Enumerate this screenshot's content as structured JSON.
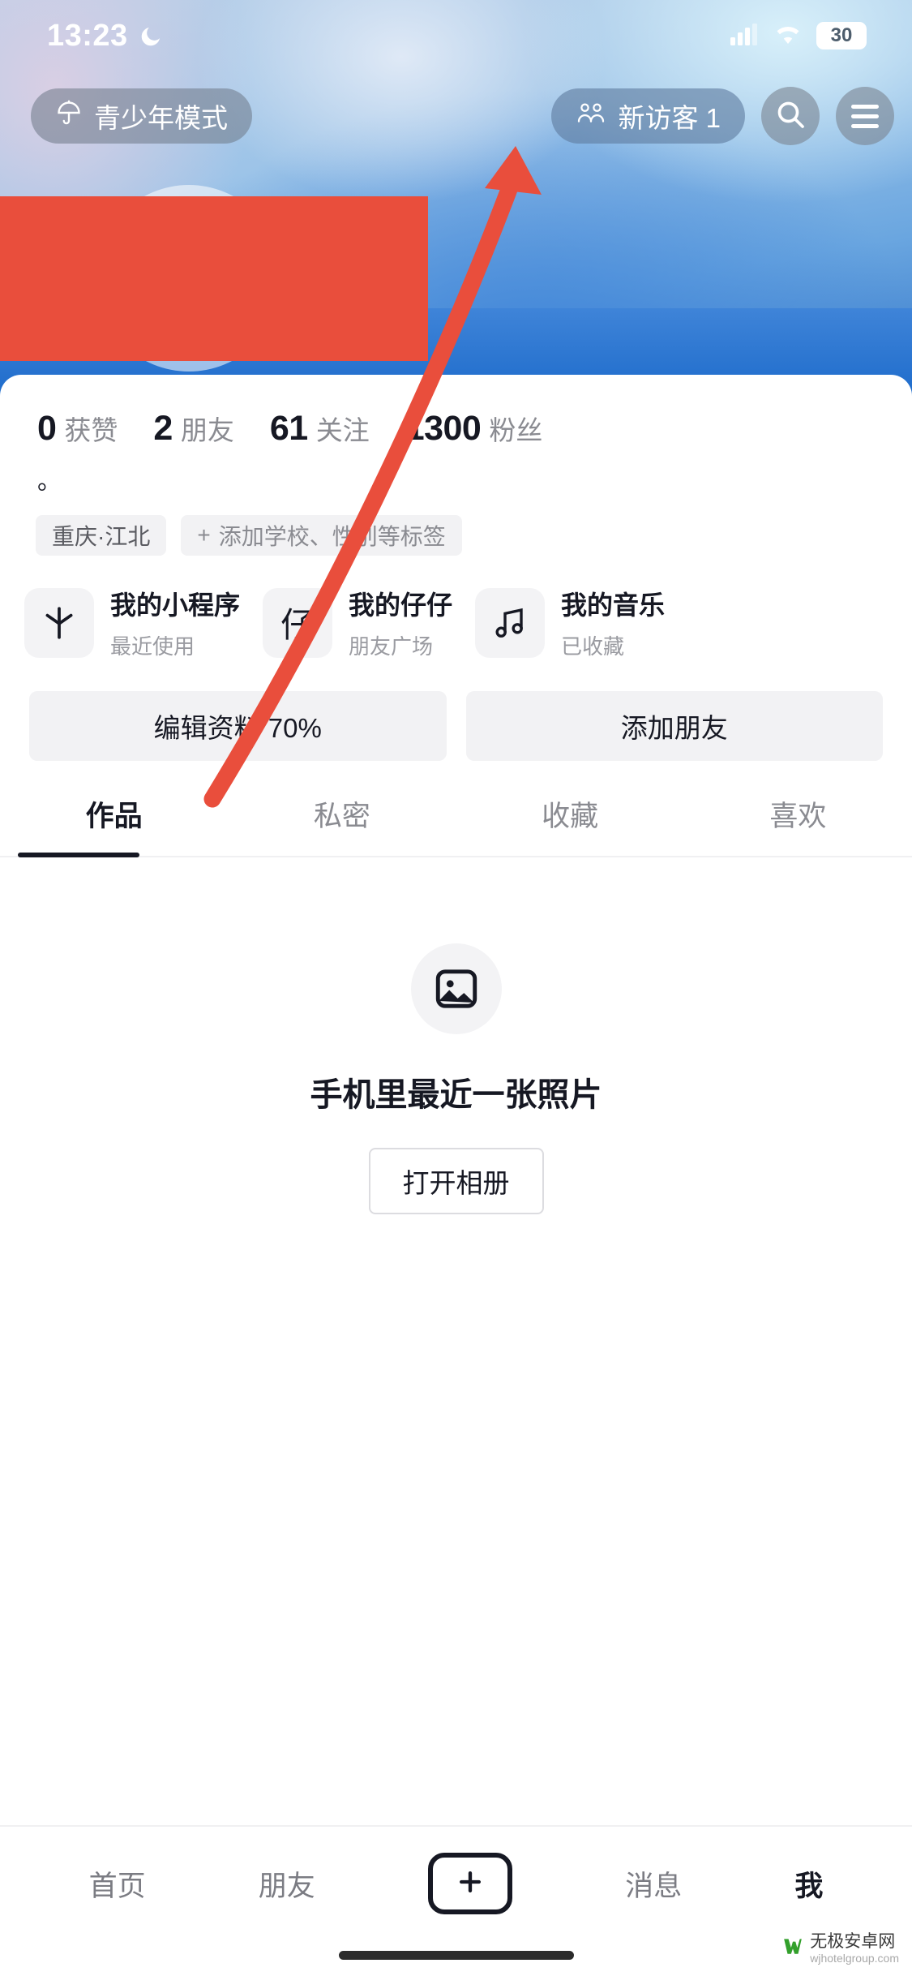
{
  "status_bar": {
    "time": "13:23",
    "moon_icon": "crescent-moon-icon",
    "cellular_icon": "cellular-signal-icon",
    "wifi_icon": "wifi-icon",
    "battery_level": "30"
  },
  "top_bar": {
    "teen_mode": {
      "label": "青少年模式",
      "icon": "umbrella-icon"
    },
    "visitors": {
      "label": "新访客 1",
      "icon": "people-icon"
    },
    "search": {
      "icon": "search-icon"
    },
    "menu": {
      "icon": "hamburger-menu-icon"
    }
  },
  "redaction": {
    "color": "#e94e3c"
  },
  "profile": {
    "stats": [
      {
        "value": "0",
        "label": "获赞"
      },
      {
        "value": "2",
        "label": "朋友"
      },
      {
        "value": "61",
        "label": "关注"
      },
      {
        "value": "1300",
        "label": "粉丝"
      }
    ],
    "bio": "。",
    "tags": [
      {
        "text": "重庆·江北",
        "is_add": false
      },
      {
        "text": "添加学校、性别等标签",
        "is_add": true,
        "prefix": "+"
      }
    ],
    "cards": [
      {
        "icon": "asterisk-icon",
        "title": "我的小程序",
        "subtitle": "最近使用"
      },
      {
        "icon": "character-zai-icon",
        "title": "我的仔仔",
        "subtitle": "朋友广场"
      },
      {
        "icon": "music-note-icon",
        "title": "我的音乐",
        "subtitle": "已收藏"
      }
    ],
    "actions": [
      {
        "label": "编辑资料 70%"
      },
      {
        "label": "添加朋友"
      }
    ]
  },
  "content_tabs": {
    "items": [
      {
        "label": "作品",
        "active": true
      },
      {
        "label": "私密",
        "active": false
      },
      {
        "label": "收藏",
        "active": false
      },
      {
        "label": "喜欢",
        "active": false
      }
    ]
  },
  "empty_state": {
    "icon": "photo-placeholder-icon",
    "title": "手机里最近一张照片",
    "button_label": "打开相册"
  },
  "bottom_nav": {
    "items": [
      {
        "label": "首页",
        "active": false
      },
      {
        "label": "朋友",
        "active": false
      },
      {
        "label": "",
        "active": false,
        "icon": "plus-icon"
      },
      {
        "label": "消息",
        "active": false
      },
      {
        "label": "我",
        "active": true
      }
    ]
  },
  "watermark": {
    "logo": "w-logo-icon",
    "name": "无极安卓网",
    "url": "wjhotelgroup.com"
  },
  "annotation": {
    "arrow_color": "#e94e3c",
    "description": "arrow pointing to hamburger menu"
  }
}
